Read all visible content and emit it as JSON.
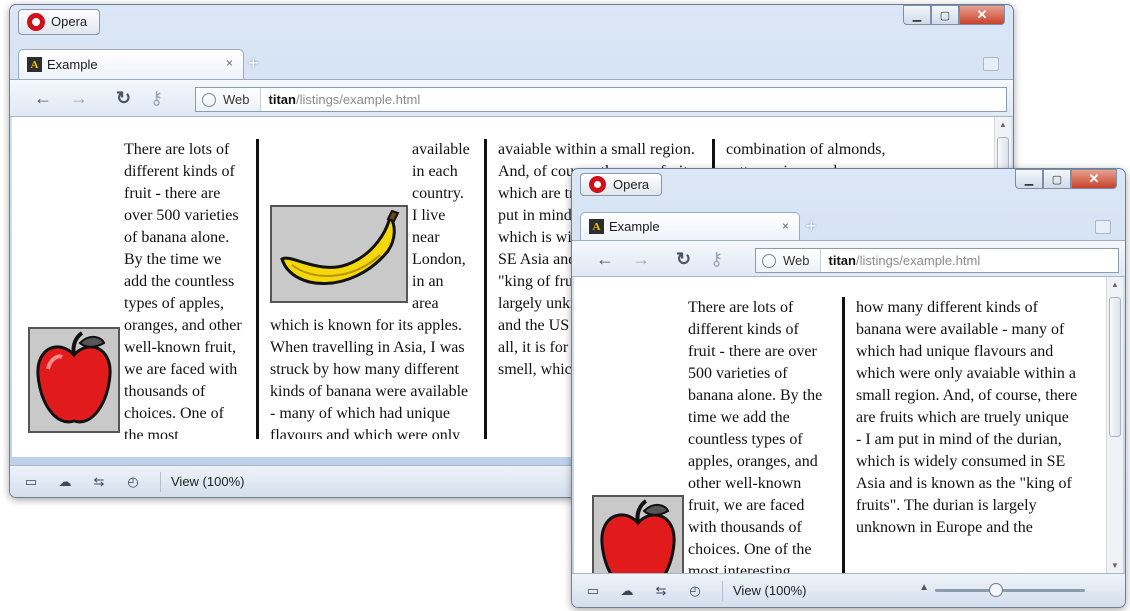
{
  "back_window": {
    "opera_label": "Opera",
    "window_controls": [
      "▁",
      "▢",
      "✕"
    ],
    "tab_label": "Example",
    "tab_close": "×",
    "new_tab": "+",
    "nav_back": "←",
    "nav_forward": "→",
    "nav_reload": "↻",
    "nav_key": "⚷",
    "web_label": "Web",
    "url_host": "titan",
    "url_path": "/listings/example.html",
    "columns": [
      "There are lots of different kinds of fruit - there are over 500 varieties of banana alone. By the time we add the countless types of apples, oranges, and other well-known fruit, we are faced with thousands of choices. One of the most interesting aspects of fruit is the variety",
      "available in each country. I live near London, in an area which is known for its apples. When travelling in Asia, I was struck by how many different kinds of banana were available - many of which had unique flavours and which were only",
      "avaiable within a small region. And, of course, there are fruits which are truely unique - I am put in mind of the durian, which is widely consumed in SE Asia and is known as the \"king of fruits\". The durian is largely unknown in Europe and the US - if it is known at all, it is for the overwhelming smell, which is compared to a",
      "combination of almonds, rotten onions and gym"
    ],
    "status_icons": [
      "▭",
      "☁",
      "⇆",
      "◴"
    ],
    "zoom_label": "View (100%)"
  },
  "front_window": {
    "opera_label": "Opera",
    "window_controls": [
      "▁",
      "▢",
      "✕"
    ],
    "tab_label": "Example",
    "tab_close": "×",
    "new_tab": "+",
    "nav_back": "←",
    "nav_forward": "→",
    "nav_reload": "↻",
    "nav_key": "⚷",
    "web_label": "Web",
    "url_host": "titan",
    "url_path": "/listings/example.html",
    "columns": [
      "There are lots of different kinds of fruit - there are over 500 varieties of banana alone. By the time we add the countless types of apples, oranges, and other well-known fruit, we are faced with thousands of choices. One of the most interesting aspects of fruit is the",
      "how many different kinds of banana were available - many of which had unique flavours and which were only avaiable within a small region. And, of course, there are fruits which are truely unique - I am put in mind of the durian, which is widely consumed in SE Asia and is known as the \"king of fruits\". The durian is largely unknown in Europe and the"
    ],
    "status_icons": [
      "▭",
      "☁",
      "⇆",
      "◴"
    ],
    "zoom_label": "View (100%)",
    "zoom_fraction": 0.4
  }
}
